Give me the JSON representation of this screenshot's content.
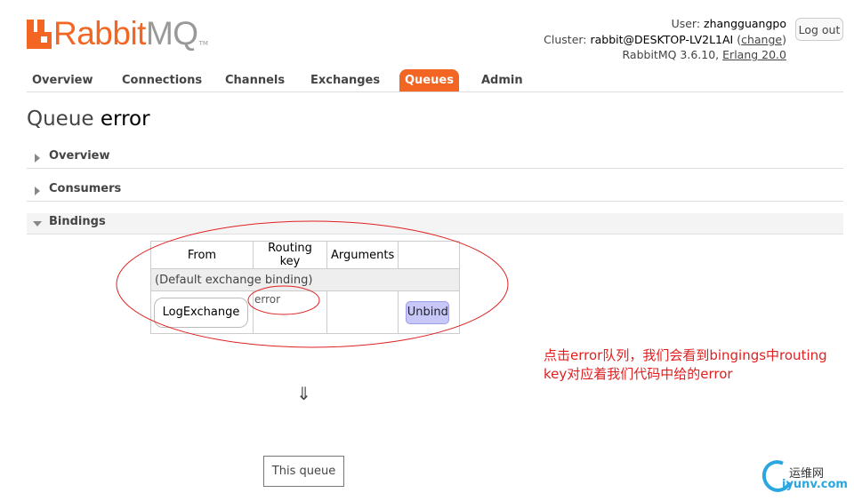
{
  "header": {
    "logo_main": "Rabbit",
    "logo_accent": "MQ",
    "logo_tm": "TM",
    "user_label": "User:",
    "user_name": "zhangguangpo",
    "cluster_label": "Cluster:",
    "cluster_name": "rabbit@DESKTOP-LV2L1AI",
    "change_link": "change",
    "version_text": "RabbitMQ 3.6.10,",
    "erlang_link": "Erlang 20.0",
    "logout_label": "Log out"
  },
  "nav": {
    "tabs": [
      {
        "label": "Overview"
      },
      {
        "label": "Connections"
      },
      {
        "label": "Channels"
      },
      {
        "label": "Exchanges"
      },
      {
        "label": "Queues",
        "active": true
      },
      {
        "label": "Admin"
      }
    ]
  },
  "page": {
    "title_prefix": "Queue",
    "queue_name": "error"
  },
  "sections": {
    "overview": "Overview",
    "consumers": "Consumers",
    "bindings": "Bindings"
  },
  "bindings_table": {
    "headers": [
      "From",
      "Routing key",
      "Arguments",
      ""
    ],
    "group_row": "(Default exchange binding)",
    "rows": [
      {
        "from": "LogExchange",
        "routing_key": "error",
        "arguments": "",
        "action": "Unbind"
      }
    ]
  },
  "flow": {
    "arrow": "⇓",
    "this_queue": "This queue"
  },
  "annotation": {
    "text": "点击error队列，我们会看到bingings中routing key对应着我们代码中给的error",
    "color": "#e02020"
  },
  "watermark": {
    "cn": "运维网",
    "en": "iyunv.com"
  },
  "colors": {
    "brand": "#f26522",
    "unbind_bg": "#c8c8f8"
  }
}
